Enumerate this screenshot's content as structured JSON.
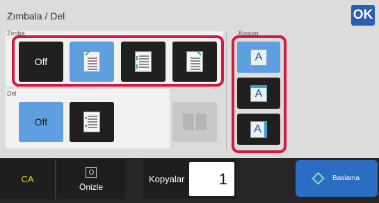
{
  "header": {
    "title": "Zımbala / Del",
    "ok_label": "OK"
  },
  "zimba": {
    "label": "Zımba",
    "off_label": "Off",
    "options": [
      {
        "icon": "staple-top-left-icon",
        "selected": true
      },
      {
        "icon": "staple-left-two-icon",
        "selected": false
      },
      {
        "icon": "staple-top-right-icon",
        "selected": false
      }
    ]
  },
  "del": {
    "label": "Del",
    "off_label": "Off",
    "options": [
      {
        "icon": "punch-left-icon",
        "selected": false
      },
      {
        "icon": "booklet-icon",
        "selected": false,
        "disabled": true
      }
    ]
  },
  "konum": {
    "label": "Konum",
    "options": [
      {
        "glyph": "A",
        "selected": true
      },
      {
        "glyph": "A",
        "selected": false
      },
      {
        "glyph": "A",
        "selected": false
      }
    ]
  },
  "bottom": {
    "ca_label": "CA",
    "preview_label": "Önizle",
    "copies_label": "Kopyalar",
    "copies_value": "1",
    "start_label": "Baslama"
  },
  "colors": {
    "accent": "#2a5fb4",
    "selected": "#5f9fe0",
    "highlight": "#d6173f",
    "start_button": "#2b6dc2"
  }
}
